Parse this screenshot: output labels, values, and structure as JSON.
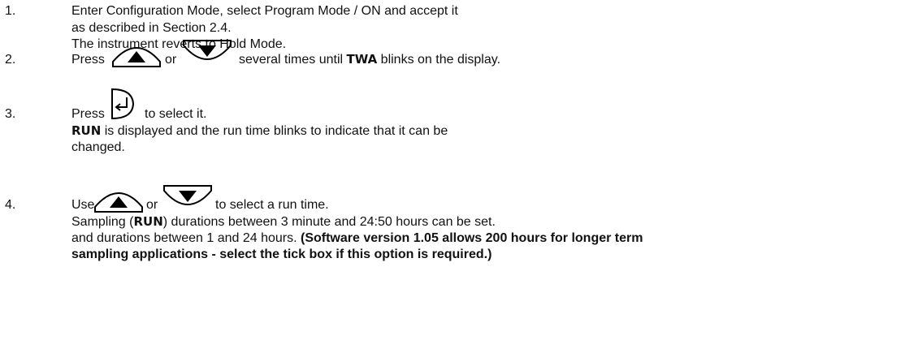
{
  "steps": [
    {
      "number": "1.",
      "lines": [
        "Enter Configuration Mode, select Program Mode / ON and accept it",
        "as described in Section 2.4.",
        "The instrument reverts to Hold Mode."
      ]
    },
    {
      "number": "2.",
      "press": "Press",
      "or": "or",
      "after": "several times until",
      "keyword": "TWA",
      "tail": "blinks on the display.",
      "icons": [
        "up-arrow-key-icon",
        "down-arrow-key-icon"
      ]
    },
    {
      "number": "3.",
      "press": "Press",
      "after": "to select it.",
      "keyword": "RUN",
      "line2_tail": "is displayed and the run time blinks to indicate that it can be",
      "line3": "changed.",
      "icons": [
        "enter-key-icon"
      ]
    },
    {
      "number": "4.",
      "use": "Use",
      "or": "or",
      "after": "to select a run time.",
      "line2_a": "Sampling (",
      "keyword": "RUN",
      "line2_b": ") durations between 3 minute and 24:50 hours can be set.",
      "line3_a": "and durations between 1 and 24 hours.",
      "line3_bold": "(Software version 1.05 allows 200 hours for longer term",
      "line4_bold": "sampling applications - select the tick box if this option is required.)",
      "icons": [
        "up-arrow-key-icon",
        "down-arrow-key-icon"
      ]
    }
  ]
}
